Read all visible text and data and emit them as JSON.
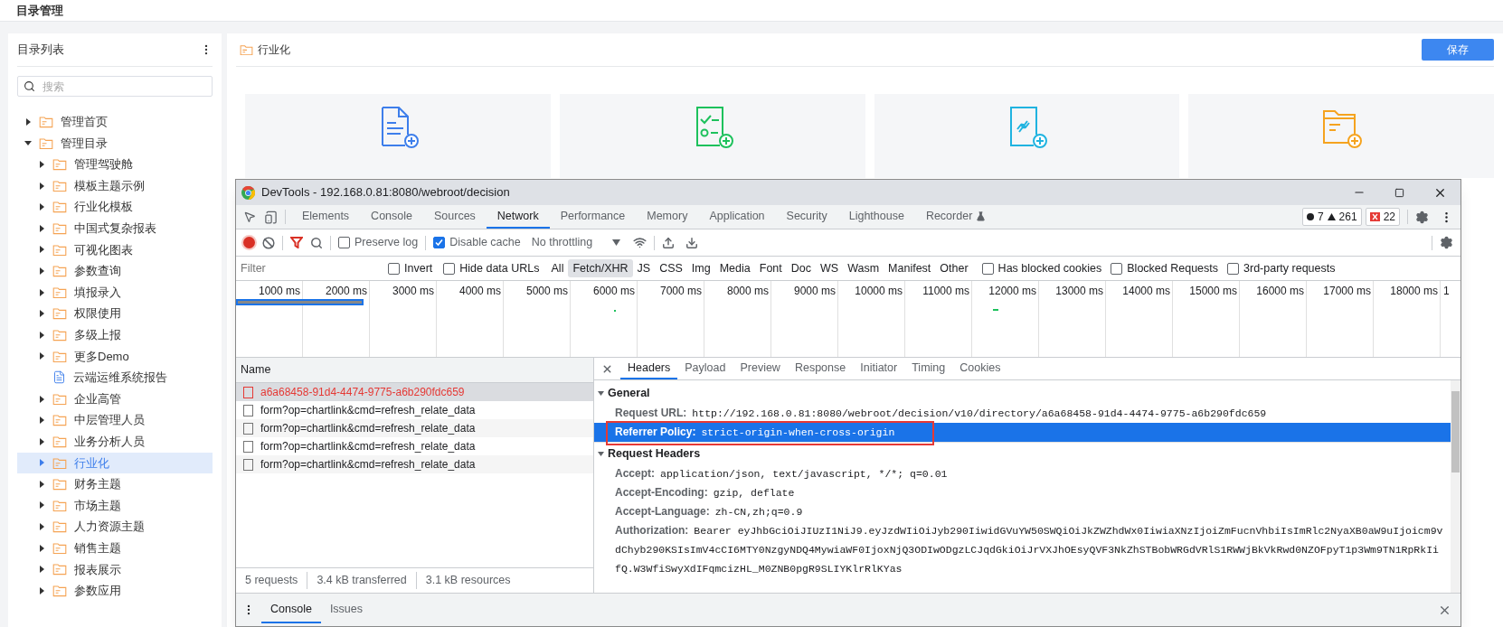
{
  "page": {
    "title": "目录管理"
  },
  "sidebar": {
    "title": "目录列表",
    "search": {
      "placeholder": "搜索"
    },
    "tree": [
      {
        "label": "管理首页",
        "kind": "folder",
        "expanded": false,
        "selected": false
      },
      {
        "label": "管理目录",
        "kind": "folder",
        "expanded": true,
        "selected": false,
        "children": [
          {
            "label": "管理驾驶舱",
            "kind": "folder",
            "expanded": false,
            "selected": false
          },
          {
            "label": "模板主题示例",
            "kind": "folder",
            "expanded": false,
            "selected": false
          },
          {
            "label": "行业化模板",
            "kind": "folder",
            "expanded": false,
            "selected": false
          },
          {
            "label": "中国式复杂报表",
            "kind": "folder",
            "expanded": false,
            "selected": false
          },
          {
            "label": "可视化图表",
            "kind": "folder",
            "expanded": false,
            "selected": false
          },
          {
            "label": "参数查询",
            "kind": "folder",
            "expanded": false,
            "selected": false
          },
          {
            "label": "填报录入",
            "kind": "folder",
            "expanded": false,
            "selected": false
          },
          {
            "label": "权限使用",
            "kind": "folder",
            "expanded": false,
            "selected": false
          },
          {
            "label": "多级上报",
            "kind": "folder",
            "expanded": false,
            "selected": false
          },
          {
            "label": "更多Demo",
            "kind": "folder",
            "expanded": false,
            "selected": false
          },
          {
            "label": "云端运维系统报告",
            "kind": "file",
            "expanded": false,
            "selected": false
          },
          {
            "label": "企业高管",
            "kind": "folder",
            "expanded": false,
            "selected": false
          },
          {
            "label": "中层管理人员",
            "kind": "folder",
            "expanded": false,
            "selected": false
          },
          {
            "label": "业务分析人员",
            "kind": "folder",
            "expanded": false,
            "selected": false
          },
          {
            "label": "行业化",
            "kind": "folder",
            "expanded": false,
            "selected": true
          },
          {
            "label": "财务主题",
            "kind": "folder",
            "expanded": false,
            "selected": false
          },
          {
            "label": "市场主题",
            "kind": "folder",
            "expanded": false,
            "selected": false
          },
          {
            "label": "人力资源主题",
            "kind": "folder",
            "expanded": false,
            "selected": false
          },
          {
            "label": "销售主题",
            "kind": "folder",
            "expanded": false,
            "selected": false
          },
          {
            "label": "报表展示",
            "kind": "folder",
            "expanded": false,
            "selected": false
          },
          {
            "label": "参数应用",
            "kind": "folder",
            "expanded": false,
            "selected": false
          }
        ]
      }
    ]
  },
  "main": {
    "title": "行业化",
    "save_button": "保存",
    "cards": [
      {
        "kind": "report"
      },
      {
        "kind": "form"
      },
      {
        "kind": "link"
      },
      {
        "kind": "folder"
      }
    ]
  },
  "devtools": {
    "title": "DevTools - 192.168.0.81:8080/webroot/decision",
    "tabs": [
      {
        "label": "Elements",
        "selected": false,
        "experimental": false
      },
      {
        "label": "Console",
        "selected": false,
        "experimental": false
      },
      {
        "label": "Sources",
        "selected": false,
        "experimental": false
      },
      {
        "label": "Network",
        "selected": true,
        "experimental": false
      },
      {
        "label": "Performance",
        "selected": false,
        "experimental": false
      },
      {
        "label": "Memory",
        "selected": false,
        "experimental": false
      },
      {
        "label": "Application",
        "selected": false,
        "experimental": false
      },
      {
        "label": "Security",
        "selected": false,
        "experimental": false
      },
      {
        "label": "Lighthouse",
        "selected": false,
        "experimental": false
      },
      {
        "label": "Recorder",
        "selected": false,
        "experimental": true
      }
    ],
    "counts": {
      "messages": "7",
      "warnings": "261",
      "errors": "22"
    },
    "toolbar": {
      "recording": true,
      "filter_active": true,
      "preserve_log": {
        "label": "Preserve log",
        "checked": false
      },
      "disable_cache": {
        "label": "Disable cache",
        "checked": true
      },
      "throttling": "No throttling"
    },
    "filter_bar": {
      "placeholder": "Filter",
      "options": [
        {
          "label": "Invert",
          "checked": false
        },
        {
          "label": "Hide data URLs",
          "checked": false
        }
      ],
      "types": [
        {
          "label": "All",
          "selected": false
        },
        {
          "label": "Fetch/XHR",
          "selected": true
        },
        {
          "label": "JS",
          "selected": false
        },
        {
          "label": "CSS",
          "selected": false
        },
        {
          "label": "Img",
          "selected": false
        },
        {
          "label": "Media",
          "selected": false
        },
        {
          "label": "Font",
          "selected": false
        },
        {
          "label": "Doc",
          "selected": false
        },
        {
          "label": "WS",
          "selected": false
        },
        {
          "label": "Wasm",
          "selected": false
        },
        {
          "label": "Manifest",
          "selected": false
        },
        {
          "label": "Other",
          "selected": false
        }
      ],
      "extra_options": [
        {
          "label": "Has blocked cookies",
          "checked": false
        },
        {
          "label": "Blocked Requests",
          "checked": false
        },
        {
          "label": "3rd-party requests",
          "checked": false
        }
      ]
    },
    "timeline": {
      "ticks": [
        "1000 ms",
        "2000 ms",
        "3000 ms",
        "4000 ms",
        "5000 ms",
        "6000 ms",
        "7000 ms",
        "8000 ms",
        "9000 ms",
        "10000 ms",
        "11000 ms",
        "12000 ms",
        "13000 ms",
        "14000 ms",
        "15000 ms",
        "16000 ms",
        "17000 ms",
        "18000 ms",
        "1"
      ]
    },
    "requests": {
      "column": "Name",
      "rows": [
        {
          "name": "a6a68458-91d4-4474-9775-a6b290fdc659",
          "failed": true,
          "selected": true
        },
        {
          "name": "form?op=chartlink&cmd=refresh_relate_data",
          "failed": false,
          "selected": false
        },
        {
          "name": "form?op=chartlink&cmd=refresh_relate_data",
          "failed": false,
          "selected": false
        },
        {
          "name": "form?op=chartlink&cmd=refresh_relate_data",
          "failed": false,
          "selected": false
        },
        {
          "name": "form?op=chartlink&cmd=refresh_relate_data",
          "failed": false,
          "selected": false
        }
      ],
      "status": [
        "5 requests",
        "3.4 kB transferred",
        "3.1 kB resources"
      ]
    },
    "details": {
      "tabs": [
        {
          "label": "Headers",
          "selected": true
        },
        {
          "label": "Payload",
          "selected": false
        },
        {
          "label": "Preview",
          "selected": false
        },
        {
          "label": "Response",
          "selected": false
        },
        {
          "label": "Initiator",
          "selected": false
        },
        {
          "label": "Timing",
          "selected": false
        },
        {
          "label": "Cookies",
          "selected": false
        }
      ],
      "sections": [
        {
          "title": "General",
          "expanded": true,
          "rows": [
            {
              "key": "Request URL:",
              "value": "http://192.168.0.81:8080/webroot/decision/v10/directory/a6a68458-91d4-4474-9775-a6b290fdc659",
              "selected": false
            },
            {
              "key": "Referrer Policy:",
              "value": "strict-origin-when-cross-origin",
              "selected": true
            }
          ]
        },
        {
          "title": "Request Headers",
          "expanded": true,
          "rows": [
            {
              "key": "Accept:",
              "value": "application/json, text/javascript, */*; q=0.01",
              "selected": false
            },
            {
              "key": "Accept-Encoding:",
              "value": "gzip, deflate",
              "selected": false
            },
            {
              "key": "Accept-Language:",
              "value": "zh-CN,zh;q=0.9",
              "selected": false
            },
            {
              "key": "Authorization:",
              "value": "Bearer eyJhbGciOiJIUzI1NiJ9.eyJzdWIiOiJyb290IiwidGVuYW50SWQiOiJkZWZhdWx0IiwiaXNzIjoiZmFucnVhbiIsImRlc2NyaXB0aW9uIjoicm9vdChyb290KSIsImV4cCI6MTY0NzgyNDQ4MywiaWF0IjoxNjQ3ODIwODgzLCJqdGkiOiJrVXJhOEsyQVF3NkZhSTBobWRGdVRlS1RWWjBkVkRwd0NZOFpyT1p3Wm9TN1RpRkIifQ.W3WfiSwyXdIFqmcizHL_M0ZNB0pgR9SLIYKlrRlKYas",
              "selected": false
            }
          ]
        }
      ]
    },
    "drawer": {
      "tabs": [
        {
          "label": "Console",
          "selected": true
        },
        {
          "label": "Issues",
          "selected": false
        }
      ]
    }
  }
}
